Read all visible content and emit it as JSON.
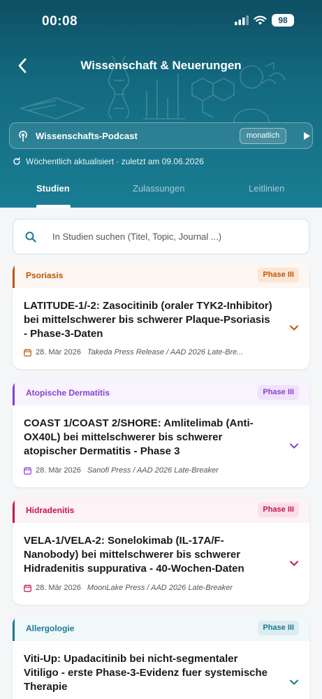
{
  "status_bar": {
    "time": "00:08",
    "battery": "98"
  },
  "header": {
    "title": "Wissenschaft & Neuerungen",
    "podcast": {
      "label": "Wissenschafts-Podcast",
      "frequency": "monatlich"
    },
    "updated": "Wöchentlich aktualisiert · zuletzt am 09.06.2026"
  },
  "tabs": [
    {
      "label": "Studien",
      "active": true
    },
    {
      "label": "Zulassungen",
      "active": false
    },
    {
      "label": "Leitlinien",
      "active": false
    }
  ],
  "search": {
    "placeholder": "In Studien suchen (Titel, Topic, Journal ...)"
  },
  "cards": [
    {
      "category": "Psoriasis",
      "phase": "Phase III",
      "color": "#b5590e",
      "head_bg": "#fdf6f1",
      "pill_bg": "#fbe6d6",
      "title": "LATITUDE-1/-2: Zasocitinib (oraler TYK2-Inhibitor) bei mittelschwerer bis schwerer Plaque-Psoriasis - Phase-3-Daten",
      "date": "28. Mär 2026",
      "source": "Takeda Press Release / AAD 2026 Late-Bre..."
    },
    {
      "category": "Atopische Dermatitis",
      "phase": "Phase III",
      "color": "#8a3fd1",
      "head_bg": "#f8f3fd",
      "pill_bg": "#eee3fb",
      "title": "COAST 1/COAST 2/SHORE: Amlitelimab (Anti-OX40L) bei mittelschwerer bis schwerer atopischer Dermatitis - Phase 3",
      "date": "28. Mär 2026",
      "source": "Sanofi Press / AAD 2026 Late-Breaker"
    },
    {
      "category": "Hidradenitis",
      "phase": "Phase III",
      "color": "#c2184f",
      "head_bg": "#fdf2f5",
      "pill_bg": "#fbdfe8",
      "title": "VELA-1/VELA-2: Sonelokimab (IL-17A/F-Nanobody) bei mittelschwerer bis schwerer Hidradenitis suppurativa - 40-Wochen-Daten",
      "date": "28. Mär 2026",
      "source": "MoonLake Press / AAD 2026 Late-Breaker"
    },
    {
      "category": "Allergologie",
      "phase": "Phase III",
      "color": "#1b7a90",
      "head_bg": "#f1f8fa",
      "pill_bg": "#dcedf2",
      "title": "Viti-Up: Upadacitinib bei nicht-segmentaler Vitiligo - erste Phase-3-Evidenz fuer systemische Therapie",
      "date": "",
      "source": ""
    }
  ]
}
